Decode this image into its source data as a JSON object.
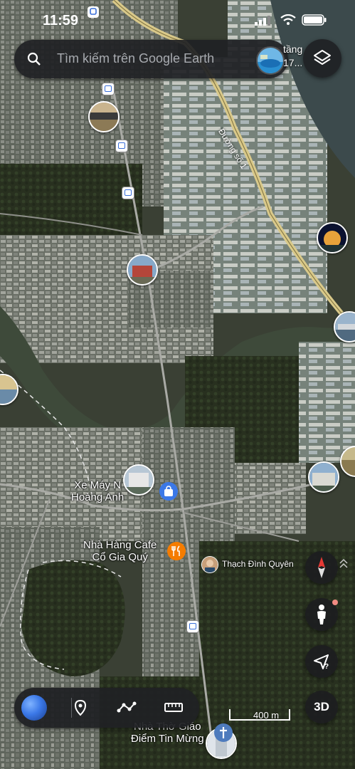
{
  "status_bar": {
    "time": "11:59"
  },
  "search": {
    "placeholder": "Tìm kiếm trên Google Earth",
    "peek_line1": "tầng",
    "peek_line2": "17..."
  },
  "map": {
    "road_label": "Đường số 1",
    "places": [
      {
        "line1": "Xe Máy N",
        "line2": "Hoàng Anh"
      },
      {
        "line1": "Nhà Hàng Cafe",
        "line2": "Cổ Gia Quý"
      },
      {
        "line1": "Thạch Đình Quyên"
      },
      {
        "line1": "Nhà Thờ Giáo",
        "line2": "Điểm Tin Mừng"
      }
    ],
    "scale": "400 m"
  },
  "controls": {
    "layers": "layers-icon",
    "compass": "compass-icon",
    "street_view": "pegman-icon",
    "location": "my-location-icon",
    "three_d_label": "3D"
  },
  "toolbar": {
    "globe": "globe-icon",
    "items": [
      "place-icon",
      "path-icon",
      "ruler-icon"
    ]
  },
  "colors": {
    "panel": "#202124",
    "river": "#3e4a3a",
    "poi_blue": "#3b78e7",
    "poi_orange": "#f57c00"
  }
}
